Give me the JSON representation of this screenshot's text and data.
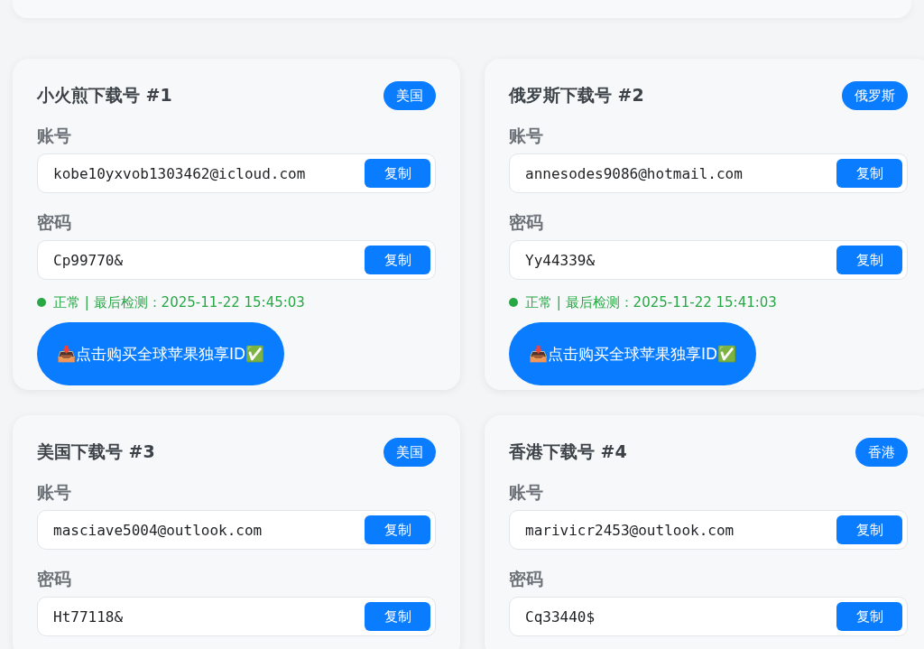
{
  "cards": [
    {
      "title": "小火煎下载号 #1",
      "badge": "美国",
      "fields": [
        {
          "label": "账号",
          "value": "kobe10yxvob1303462@icloud.com",
          "button": "复制"
        },
        {
          "label": "密码",
          "value": "Cp99770&",
          "button": "复制"
        }
      ],
      "status": {
        "text": "正常 | 最后检测：2025-11-22 15:45:03",
        "color": "#28a745"
      },
      "buy_button": "📥点击购买全球苹果独享ID✅"
    },
    {
      "title": "俄罗斯下载号 #2",
      "badge": "俄罗斯",
      "fields": [
        {
          "label": "账号",
          "value": "annesodes9086@hotmail.com",
          "button": "复制"
        },
        {
          "label": "密码",
          "value": "Yy44339&",
          "button": "复制"
        }
      ],
      "status": {
        "text": "正常 | 最后检测：2025-11-22 15:41:03",
        "color": "#28a745"
      },
      "buy_button": "📥点击购买全球苹果独享ID✅"
    },
    {
      "title": "美国下载号 #3",
      "badge": "美国",
      "fields": [
        {
          "label": "账号",
          "value": "masciave5004@outlook.com",
          "button": "复制"
        },
        {
          "label": "密码",
          "value": "Ht77118&",
          "button": "复制"
        }
      ]
    },
    {
      "title": "香港下载号 #4",
      "badge": "香港",
      "fields": [
        {
          "label": "账号",
          "value": "marivicr2453@outlook.com",
          "button": "复制"
        },
        {
          "label": "密码",
          "value": "Cq33440$",
          "button": "复制"
        }
      ]
    }
  ]
}
